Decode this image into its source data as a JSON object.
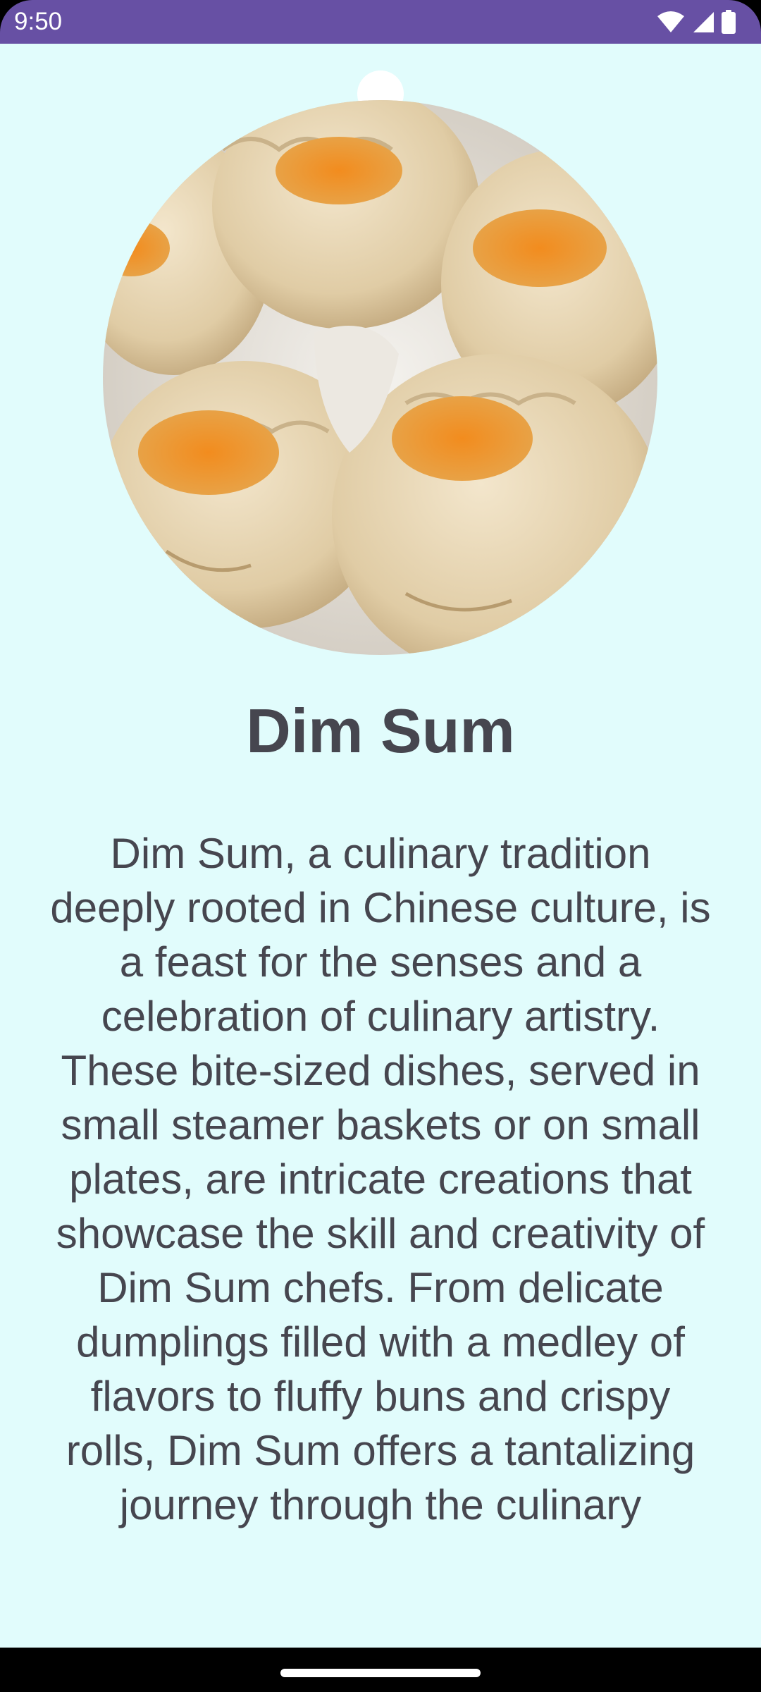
{
  "status_bar": {
    "time": "9:50",
    "icons": [
      "wifi-icon",
      "cellular-signal-icon",
      "battery-icon"
    ],
    "background_color": "#6750A4"
  },
  "detail": {
    "image_alt": "Dim Sum",
    "title": "Dim Sum",
    "description": "Dim Sum, a culinary tradition deeply rooted in Chinese culture, is a feast for the senses and a celebration of culinary artistry. These bite-sized dishes, served in small steamer baskets or on small plates, are intricate creations that showcase the skill and creativity of Dim Sum chefs. From delicate dumplings filled with a medley of flavors to fluffy buns and crispy rolls, Dim Sum offers a tantalizing journey through the culinary",
    "background_color": "#E1FCFC",
    "text_color": "#46464F"
  },
  "navigation": {
    "home_indicator": "home-indicator"
  }
}
